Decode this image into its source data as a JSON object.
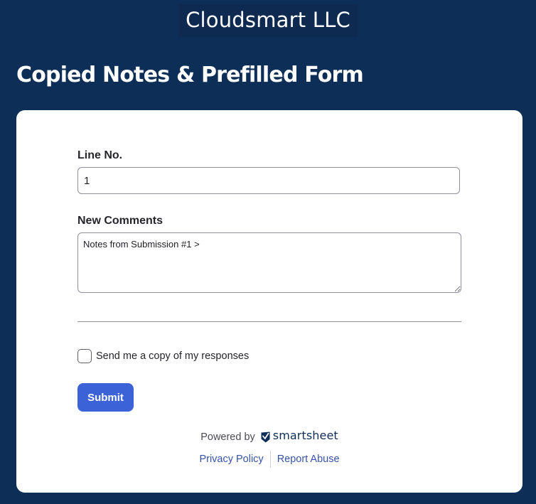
{
  "header": {
    "company_name": "Cloudsmart LLC",
    "form_title": "Copied Notes & Prefilled Form"
  },
  "form": {
    "line_no": {
      "label": "Line No.",
      "value": "1"
    },
    "new_comments": {
      "label": "New Comments",
      "value": "Notes from Submission #1 >"
    },
    "send_copy": {
      "label": "Send me a copy of my responses",
      "checked": false
    },
    "submit_label": "Submit"
  },
  "footer": {
    "powered_by": "Powered by",
    "brand_name": "smartsheet",
    "brand_icon": "smartsheet-logo-icon",
    "links": {
      "privacy": "Privacy Policy",
      "report": "Report Abuse"
    }
  },
  "colors": {
    "background": "#0d2e57",
    "card": "#ffffff",
    "primary_button": "#3b62d6",
    "link": "#3653a8"
  }
}
